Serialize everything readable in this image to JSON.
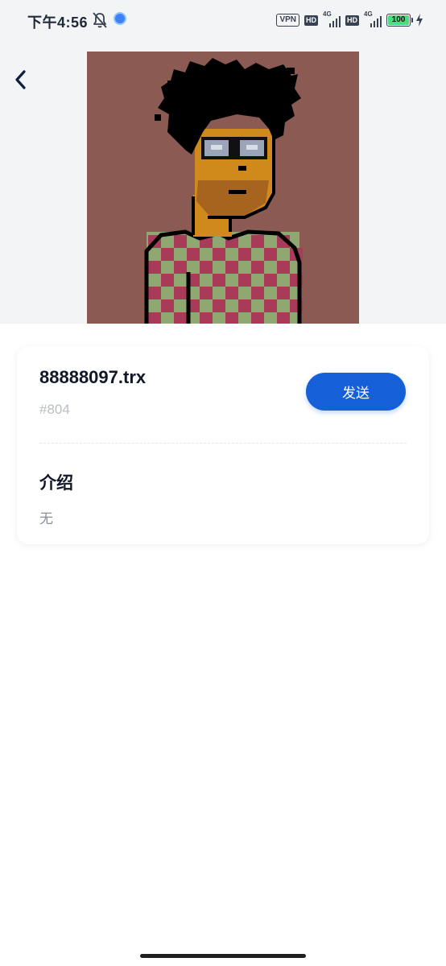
{
  "status_bar": {
    "time": "下午4:56",
    "vpn": "VPN",
    "hd1": "HD",
    "net1": "4G",
    "hd2": "HD",
    "net2": "4G",
    "battery": "100"
  },
  "nft": {
    "name": "88888097.trx",
    "id": "#804"
  },
  "actions": {
    "send_label": "发送"
  },
  "intro": {
    "title": "介绍",
    "text": "无"
  },
  "colors": {
    "accent": "#1560d8",
    "card_background": "#ffffff",
    "nft_background": "#8b5a52"
  },
  "icons": {
    "back": "chevron-left-icon",
    "mute": "bell-off-icon",
    "charging": "lightning-icon"
  }
}
